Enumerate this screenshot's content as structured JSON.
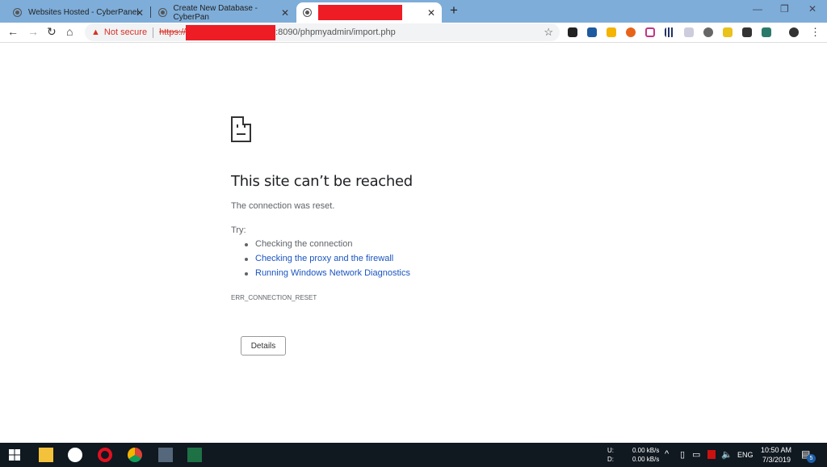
{
  "browser": {
    "tabs": [
      {
        "title": "Websites Hosted - CyberPanel",
        "active": false
      },
      {
        "title": "Create New Database - CyberPan",
        "active": false
      },
      {
        "title": "",
        "active": true
      }
    ],
    "address": {
      "security_label": "Not secure",
      "scheme": "https://",
      "url_suffix": ":8090/phpmyadmin/import.php"
    },
    "extensions": [
      "ghostery",
      "toolbox",
      "colorzilla",
      "sq",
      "instagram",
      "equalizer",
      "git",
      "bolt",
      "vimeo",
      "bulb",
      "shield"
    ]
  },
  "page": {
    "title": "This site can’t be reached",
    "message": "The connection was reset.",
    "try_label": "Try:",
    "suggestions": [
      {
        "text": "Checking the connection",
        "link": false
      },
      {
        "text": "Checking the proxy and the firewall",
        "link": true
      },
      {
        "text": "Running Windows Network Diagnostics",
        "link": true
      }
    ],
    "error_code": "ERR_CONNECTION_RESET",
    "details_button": "Details"
  },
  "taskbar": {
    "apps": [
      "file-explorer",
      "ubuntu",
      "opera",
      "chrome",
      "app",
      "excel"
    ],
    "net": {
      "up_label": "U:",
      "down_label": "D:",
      "up": "0.00 kB/s",
      "down": "0.00 kB/s"
    },
    "lang": "ENG",
    "time": "10:50 AM",
    "date": "7/3/2019",
    "notifications": "5"
  }
}
